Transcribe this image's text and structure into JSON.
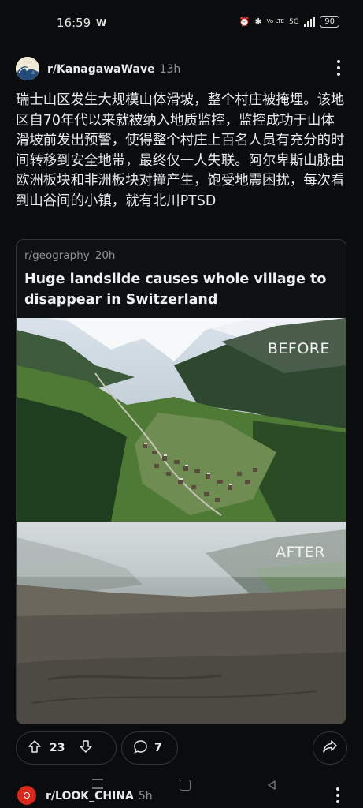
{
  "status_bar": {
    "time": "16:59",
    "notif": "W",
    "volte": "Vo LTE",
    "net": "5G",
    "battery": "90"
  },
  "post": {
    "subreddit": "r/KanagawaWave",
    "age": "13h",
    "body": "瑞士山区发生大规模山体滑坡，整个村庄被掩埋。该地区自70年代以来就被纳入地质监控，监控成功于山体滑坡前发出预警，使得整个村庄上百名人员有充分的时间转移到安全地带，最终仅一人失联。阿尔卑斯山脉由欧洲板块和非洲板块对撞产生，饱受地震困扰，每次看到山谷间的小镇，就有北川PTSD",
    "crosspost": {
      "subreddit": "r/geography",
      "age": "20h",
      "title": "Huge landslide causes whole village to disappear in Switzerland",
      "label_before": "BEFORE",
      "label_after": "AFTER"
    },
    "votes": "23",
    "comments": "7"
  },
  "next_post": {
    "subreddit": "r/LOOK_CHINA",
    "age": "5h"
  },
  "icons": [
    "upvote-icon",
    "downvote-icon",
    "comment-icon",
    "share-icon",
    "more-icon"
  ]
}
